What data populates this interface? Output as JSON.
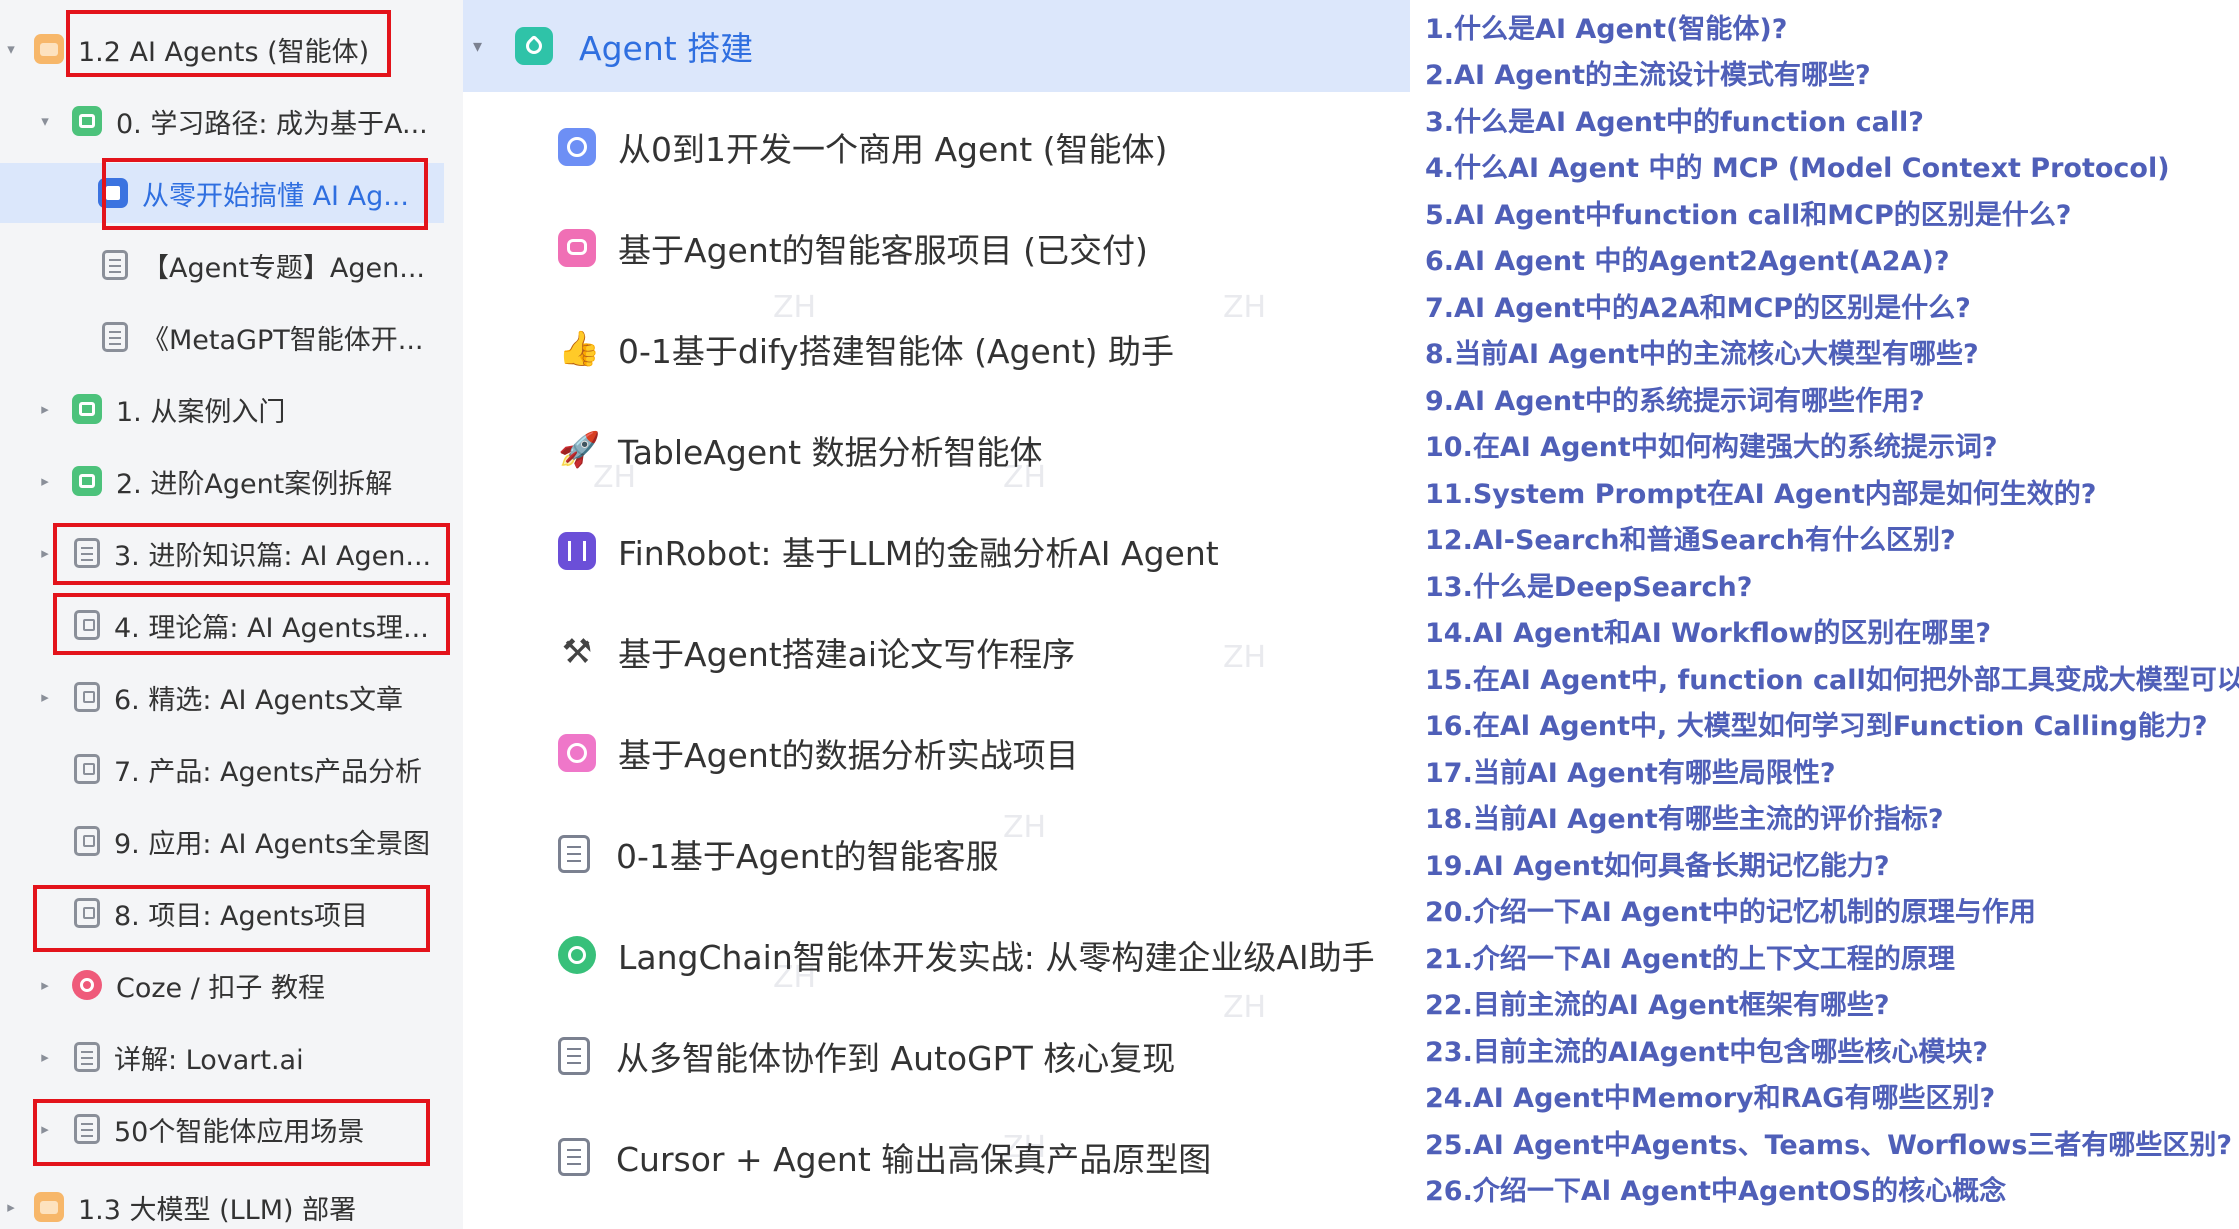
{
  "tree": {
    "items": [
      {
        "label": "1.2 AI Agents (智能体)",
        "icon": "folder-orange-icon",
        "caret": "▾"
      },
      {
        "label": "0. 学习路径: 成为基于A...",
        "icon": "folder-green-icon",
        "caret": "▾"
      },
      {
        "label": "从零开始搞懂 AI Ag...",
        "icon": "doc-blue-icon",
        "caret": ""
      },
      {
        "label": "【Agent专题】Agen...",
        "icon": "doc-icon",
        "caret": ""
      },
      {
        "label": "《MetaGPT智能体开...",
        "icon": "doc-icon",
        "caret": ""
      },
      {
        "label": "1. 从案例入门",
        "icon": "folder-green-icon",
        "caret": "▸"
      },
      {
        "label": "2. 进阶Agent案例拆解",
        "icon": "folder-green-icon",
        "caret": "▸"
      },
      {
        "label": "3. 进阶知识篇: AI Agen...",
        "icon": "doc-icon",
        "caret": "▸"
      },
      {
        "label": "4. 理论篇: AI Agents理...",
        "icon": "board-icon",
        "caret": ""
      },
      {
        "label": "6. 精选: AI Agents文章",
        "icon": "board-icon",
        "caret": "▸"
      },
      {
        "label": "7. 产品: Agents产品分析",
        "icon": "board-icon",
        "caret": ""
      },
      {
        "label": "9. 应用: AI Agents全景图",
        "icon": "board-icon",
        "caret": ""
      },
      {
        "label": "8. 项目: Agents项目",
        "icon": "board-icon",
        "caret": ""
      },
      {
        "label": "Coze / 扣子 教程",
        "icon": "coze-icon",
        "caret": "▸"
      },
      {
        "label": "详解: Lovart.ai",
        "icon": "doc-icon",
        "caret": "▸"
      },
      {
        "label": "50个智能体应用场景",
        "icon": "doc-icon",
        "caret": "▸"
      },
      {
        "label": "1.3 大模型 (LLM) 部署",
        "icon": "folder-orange-icon",
        "caret": "▸"
      }
    ]
  },
  "middle": {
    "header": {
      "caret": "▾",
      "title": "Agent 搭建"
    },
    "items": [
      {
        "label": "从0到1开发一个商用 Agent (智能体)",
        "icon": "clock-icon"
      },
      {
        "label": "基于Agent的智能客服项目 (已交付)",
        "icon": "chat-icon"
      },
      {
        "label": "0-1基于dify搭建智能体 (Agent) 助手",
        "icon": "thumbs-up-icon",
        "glyph": "👍"
      },
      {
        "label": "TableAgent 数据分析智能体",
        "icon": "rocket-icon",
        "glyph": "🚀"
      },
      {
        "label": "FinRobot: 基于LLM的金融分析AI Agent",
        "icon": "robot-icon"
      },
      {
        "label": "基于Agent搭建ai论文写作程序",
        "icon": "tools-icon",
        "glyph": "⚒"
      },
      {
        "label": "基于Agent的数据分析实战项目",
        "icon": "chart-icon"
      },
      {
        "label": "0-1基于Agent的智能客服",
        "icon": "doc-icon"
      },
      {
        "label": "LangChain智能体开发实战: 从零构建企业级AI助手",
        "icon": "globe-icon"
      },
      {
        "label": "从多智能体协作到 AutoGPT 核心复现",
        "icon": "doc-icon"
      },
      {
        "label": "Cursor + Agent 输出高保真产品原型图",
        "icon": "doc-icon"
      }
    ],
    "watermark": "ZH"
  },
  "questions": [
    "1.什么是AI Agent(智能体)?",
    "2.AI Agent的主流设计模式有哪些?",
    "3.什么是AI Agent中的function call?",
    "4.什么AI Agent 中的 MCP (Model Context Protocol)",
    "5.AI Agent中function call和MCP的区别是什么?",
    "6.AI Agent 中的Agent2Agent(A2A)?",
    "7.AI Agent中的A2A和MCP的区别是什么?",
    "8.当前AI Agent中的主流核心大模型有哪些?",
    "9.AI Agent中的系统提示词有哪些作用?",
    "10.在AI Agent中如何构建强大的系统提示词?",
    "11.System Prompt在AI Agent内部是如何生效的?",
    "12.AI-Search和普通Search有什么区别?",
    "13.什么是DeepSearch?",
    "14.AI Agent和AI Workflow的区别在哪里?",
    "15.在AI Agent中, function call如何把外部工具变成大模型可以",
    "16.在Al Agent中, 大模型如何学习到Function Calling能力?",
    "17.当前AI Agent有哪些局限性?",
    "18.当前AI Agent有哪些主流的评价指标?",
    "19.AI Agent如何具备长期记忆能力?",
    "20.介绍一下AI Agent中的记忆机制的原理与作用",
    "21.介绍一下AI Agent的上下文工程的原理",
    "22.目前主流的AI Agent框架有哪些?",
    "23.目前主流的AIAgent中包含哪些核心模块?",
    "24.AI Agent中Memory和RAG有哪些区别?",
    "25.AI Agent中Agents、Teams、Worflows三者有哪些区别?",
    "26.介绍一下Al Agent中AgentOS的核心概念"
  ],
  "colors": {
    "highlight_box": "#e3131b",
    "question_text": "#4f5fb8",
    "selected_bg": "#dbe7fb",
    "link_blue": "#2f6fe0"
  }
}
